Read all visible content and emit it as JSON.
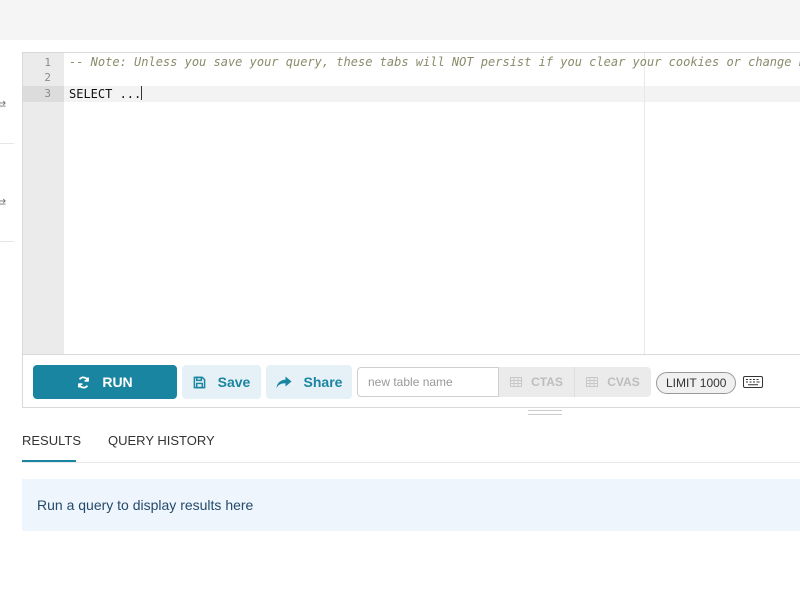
{
  "editor": {
    "line_numbers": [
      "1",
      "2",
      "3"
    ],
    "lines": [
      "-- Note: Unless you save your query, these tabs will NOT persist if you clear your cookies or change browsers.",
      "",
      "SELECT ..."
    ]
  },
  "toolbar": {
    "run_label": "RUN",
    "save_label": "Save",
    "share_label": "Share",
    "table_name_placeholder": "new table name",
    "ctas_label": "CTAS",
    "cvas_label": "CVAS",
    "limit_label": "LIMIT 1000"
  },
  "tabs": {
    "results": "RESULTS",
    "history": "QUERY HISTORY",
    "active": "RESULTS"
  },
  "results": {
    "empty_message": "Run a query to display results here"
  },
  "colors": {
    "accent": "#1a85a0",
    "button_secondary_bg": "#e5f1f6",
    "info_bg": "#eef5fc"
  },
  "icons": {
    "run": "sync-icon",
    "save": "floppy-disk-icon",
    "share": "share-arrow-icon",
    "ctas": "table-icon",
    "cvas": "table-icon",
    "shortcuts": "keyboard-icon"
  }
}
